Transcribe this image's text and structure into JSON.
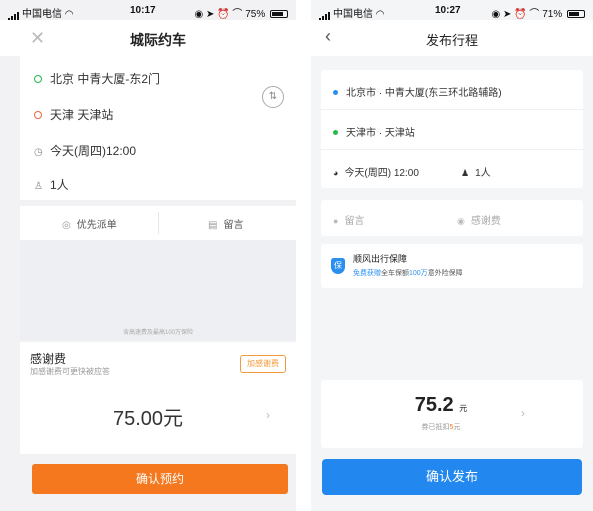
{
  "left": {
    "status": {
      "carrier": "中国电信",
      "time": "10:17",
      "battery": "75%",
      "battery_level": 0.75
    },
    "title": "城际约车",
    "route": {
      "from": "北京 中青大厦-东2门",
      "to": "天津 天津站",
      "time": "今天(周四)12:00",
      "passengers": "1人"
    },
    "options": {
      "priority": "优先派单",
      "message": "留言"
    },
    "insurance_note": "含高速费及最高100万保险",
    "fee": {
      "title": "感谢费",
      "subtitle": "加感谢费可更快被应答",
      "button": "加感谢费"
    },
    "price": "75.00元",
    "confirm": "确认预约"
  },
  "right": {
    "status": {
      "carrier": "中国电信",
      "time": "10:27",
      "battery": "71%",
      "battery_level": 0.71
    },
    "title": "发布行程",
    "route": {
      "from": "北京市 · 中青大厦(东三环北路辅路)",
      "to": "天津市 · 天津站",
      "time": "今天(周四) 12:00",
      "passengers": "1人"
    },
    "message": "留言",
    "thanks_fee": "感谢费",
    "guarantee": {
      "title": "顺风出行保障",
      "free": "免费获赠",
      "mid": "全车保额",
      "amount": "100万",
      "tail": "意外险保障"
    },
    "price": {
      "value": "75.2",
      "unit": "元",
      "credit_prefix": "券已抵扣",
      "credit_amount": "5",
      "credit_suffix": "元"
    },
    "confirm": "确认发布"
  },
  "colors": {
    "orange": "#f5781e",
    "blue": "#2287ee",
    "green": "#27b84a",
    "red": "#f0643c"
  }
}
